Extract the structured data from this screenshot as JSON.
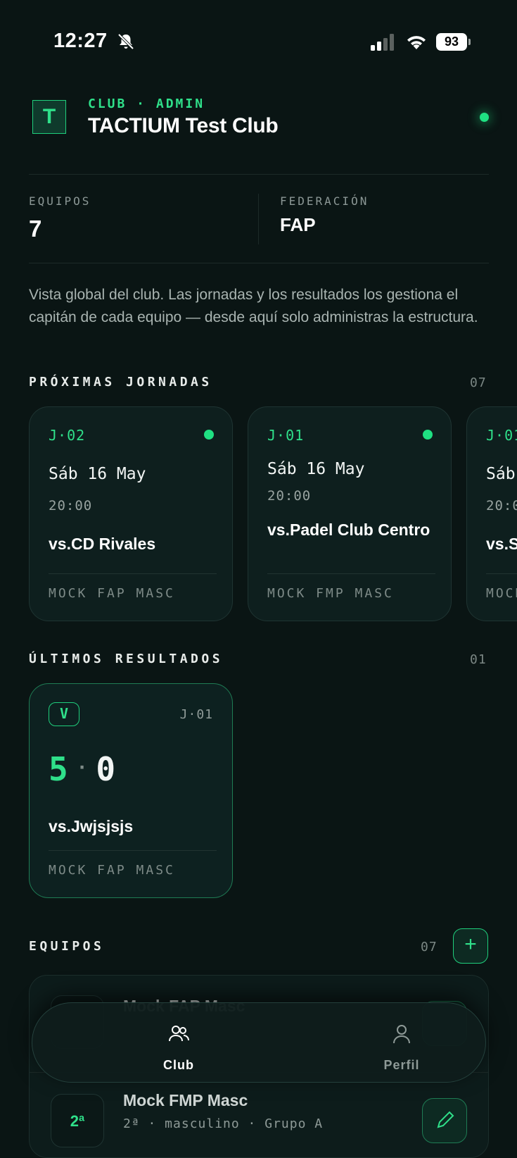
{
  "status_bar": {
    "time": "12:27",
    "battery": "93"
  },
  "header": {
    "logo_letter": "T",
    "kicker": "CLUB · ADMIN",
    "club_name": "TACTIUM Test Club"
  },
  "stats": {
    "teams_label": "EQUIPOS",
    "teams_value": "7",
    "federation_label": "FEDERACIÓN",
    "federation_value": "FAP"
  },
  "intro": "Vista global del club. Las jornadas y los resultados los gestiona el capitán de cada equipo — desde aquí solo administras la estructura.",
  "upcoming": {
    "title": "PRÓXIMAS JORNADAS",
    "count": "07",
    "cards": [
      {
        "round": "J·02",
        "date": "Sáb 16 May",
        "time": "20:00",
        "opponent": "vs.CD Rivales",
        "league": "MOCK FAP MASC"
      },
      {
        "round": "J·01",
        "date": "Sáb 16 May",
        "time": "20:00",
        "opponent": "vs.Padel Club Centro",
        "league": "MOCK FMP MASC"
      },
      {
        "round": "J·01",
        "date": "Sáb",
        "time": "20:0",
        "opponent": "vs.S",
        "league": "MOCK"
      }
    ]
  },
  "results": {
    "title": "ÚLTIMOS RESULTADOS",
    "count": "01",
    "cards": [
      {
        "badge": "V",
        "round": "J·01",
        "score_for": "5",
        "score_sep": "·",
        "score_against": "0",
        "opponent": "vs.Jwjsjsjs",
        "league": "MOCK FAP MASC"
      }
    ]
  },
  "teams": {
    "title": "EQUIPOS",
    "count": "07",
    "add_label": "+",
    "rows": [
      {
        "name": "Mock FAP Masc",
        "rank": "",
        "sub": ""
      },
      {
        "name": "Mock FMP Masc",
        "rank": "2ª",
        "sub": "2ª · masculino · Grupo A"
      }
    ]
  },
  "nav": {
    "items": [
      {
        "label": "Club",
        "active": true
      },
      {
        "label": "Perfil",
        "active": false
      }
    ]
  },
  "colors": {
    "accent": "#2fe08a",
    "background": "#0a1514",
    "card": "#0e1f1e"
  }
}
